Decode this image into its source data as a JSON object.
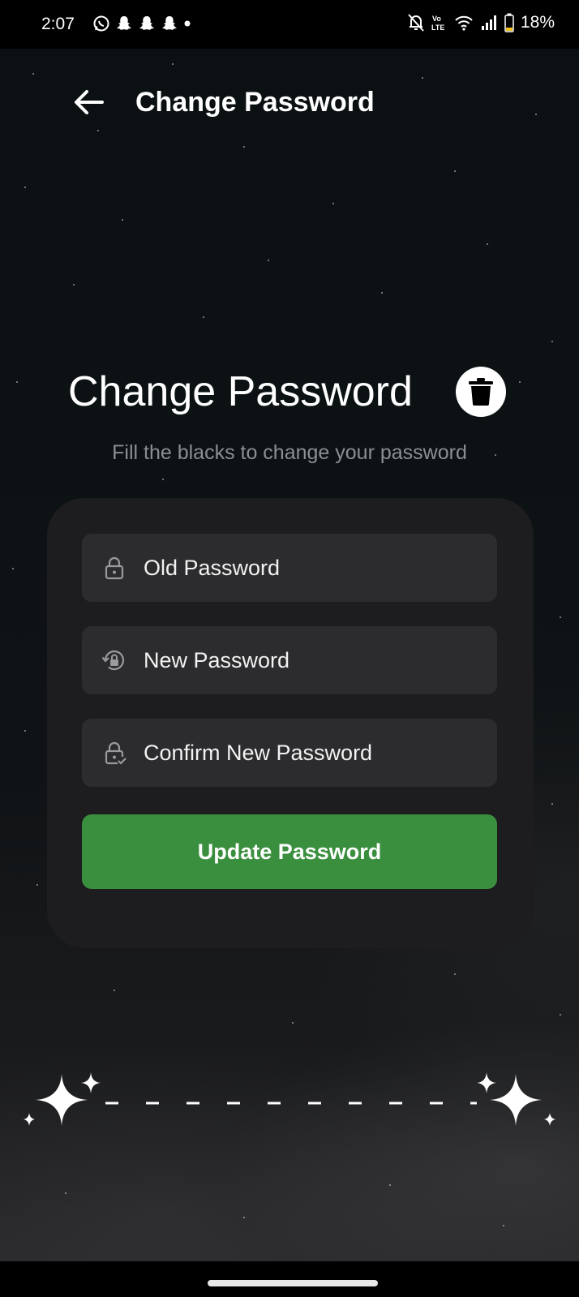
{
  "status_bar": {
    "time": "2:07",
    "battery": "18%",
    "left_icons": [
      "whatsapp-icon",
      "snapchat-icon",
      "snapchat-icon",
      "snapchat-icon",
      "dot-icon"
    ],
    "right_icons": [
      "mute-bell-icon",
      "volte-icon",
      "wifi-icon",
      "signal-icon",
      "battery-icon"
    ]
  },
  "header": {
    "title": "Change Password"
  },
  "main": {
    "title": "Change Password",
    "subtitle": "Fill the blacks to change your password"
  },
  "form": {
    "old_password": {
      "placeholder": "Old Password",
      "icon": "lock-icon"
    },
    "new_password": {
      "placeholder": "New Password",
      "icon": "lock-reset-icon"
    },
    "confirm_password": {
      "placeholder": "Confirm New Password",
      "icon": "lock-check-icon"
    },
    "submit_label": "Update Password"
  },
  "colors": {
    "button": "#3a8f3e",
    "card": "#1d1c1e",
    "field": "#2c2c2e",
    "subtitle": "#8a8f93"
  }
}
